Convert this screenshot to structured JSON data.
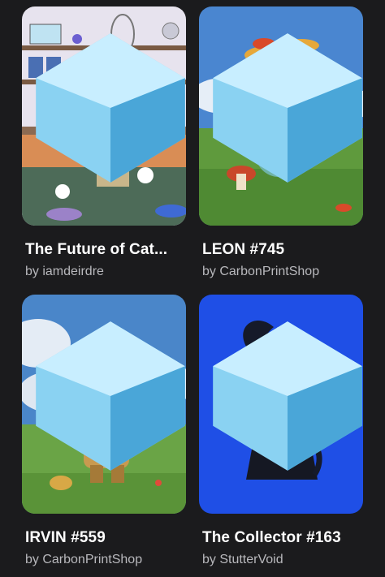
{
  "grid": {
    "items": [
      {
        "title": "The Future of Cat...",
        "creator": "by iamdeirdre",
        "image": "cartoon-cat-pet-shop"
      },
      {
        "title": "LEON #745",
        "creator": "by CarbonPrintShop",
        "image": "mushroom-creature-landscape"
      },
      {
        "title": "IRVIN #559",
        "creator": "by CarbonPrintShop",
        "image": "tree-robot-creature-meadow"
      },
      {
        "title": "The Collector #163",
        "creator": "by StutterVoid",
        "image": "dark-character-blue-background"
      }
    ],
    "chain_icon": "polygon-diamond-icon"
  },
  "colors": {
    "background": "#1b1b1d",
    "title_text": "#ffffff",
    "creator_text": "#b8b8bc",
    "collector_bg": "#1f4fe6"
  }
}
